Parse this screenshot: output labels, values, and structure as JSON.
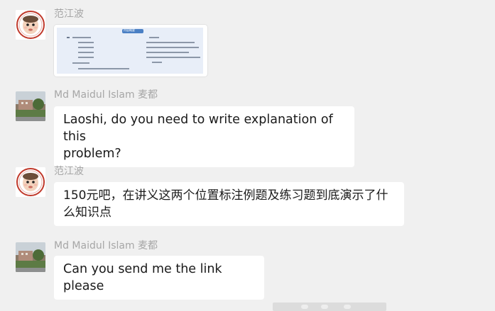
{
  "messages": [
    {
      "sender": "范江波",
      "type": "image"
    },
    {
      "sender": "Md Maidul Islam 麦都",
      "type": "text",
      "lines": [
        "Laoshi, do you need to write explanation of this",
        "problem?"
      ]
    },
    {
      "sender": "范江波",
      "type": "text",
      "lines": [
        "150元吧，在讲义这两个位置标注例题及练习题到底演示了什",
        "么知识点"
      ]
    },
    {
      "sender": "Md Maidul Islam 麦都",
      "type": "text",
      "lines": [
        "Can you send me the link please"
      ]
    }
  ],
  "image_preview": {
    "tag": "内容概要",
    "left_column": [
      "1 Example:",
      "1. Kgf02-01.c",
      "2. Kgf02-01c",
      "3. Kgf02-04.c",
      "4. Kgf02-05.c",
      "II Exercise:",
      "1. Exercise:AC100-A - Multiplica-"
    ],
    "right_column": [
      "tion 1",
      "2. Exercise:AC173-A - Calc",
      "3. Exercise:AC174-A-Dishwagon",
      "4. Exercise: AC100-A - bus",
      "5. Exercise:AC209-A-Anyway Take",
      "Saali"
    ]
  },
  "colors": {
    "background": "#f0f0f0",
    "bubble": "#ffffff",
    "sender": "#a6a6a6",
    "text": "#1a1a1a"
  }
}
